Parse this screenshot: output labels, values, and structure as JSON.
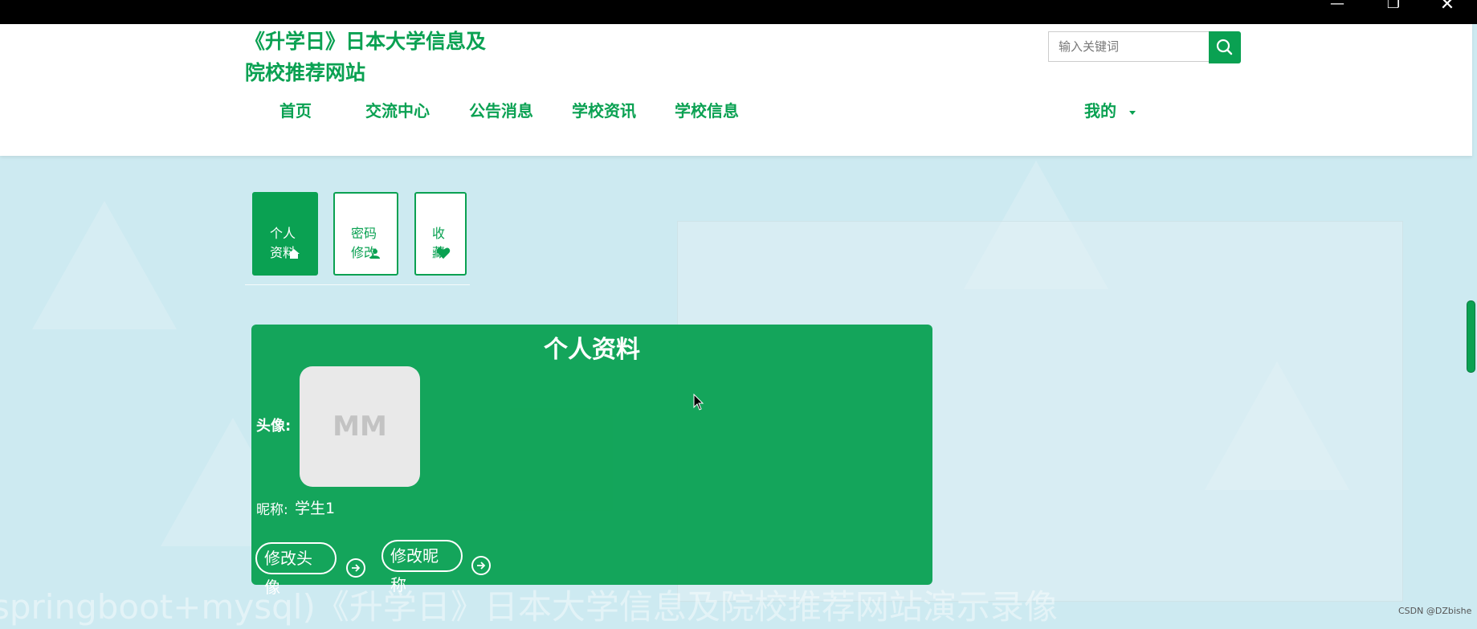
{
  "window": {
    "min": "—",
    "max": "❐",
    "close": "✕"
  },
  "header": {
    "site_title": "《升学日》日本大学信息及院校推荐网站",
    "search_placeholder": "输入关键词",
    "nav": [
      {
        "label": "首页"
      },
      {
        "label": "交流中心"
      },
      {
        "label": "公告消息"
      },
      {
        "label": "学校资讯"
      },
      {
        "label": "学校信息"
      }
    ],
    "my_label": "我的"
  },
  "tabs": [
    {
      "label": "个人\n资料",
      "icon": "home-icon",
      "active": true
    },
    {
      "label": "密码\n修改",
      "icon": "user-icon",
      "active": false
    },
    {
      "label": "收\n藏",
      "icon": "heart-icon",
      "active": false
    }
  ],
  "panel": {
    "title": "个人资料",
    "avatar_label": "头像:",
    "avatar_text": "MM",
    "nickname_label": "昵称:",
    "nickname_value": "学生1",
    "change_avatar": "修改头像",
    "change_nickname": "修改昵称"
  },
  "background": {
    "watermark": "springboot+mysql)《升学日》日本大学信息及院校推荐网站演示录像"
  },
  "footer": {
    "credit": "CSDN @DZbishe"
  },
  "colors": {
    "accent": "#0aa152",
    "panel": "#0aa152",
    "background": "#cdeaf1"
  }
}
